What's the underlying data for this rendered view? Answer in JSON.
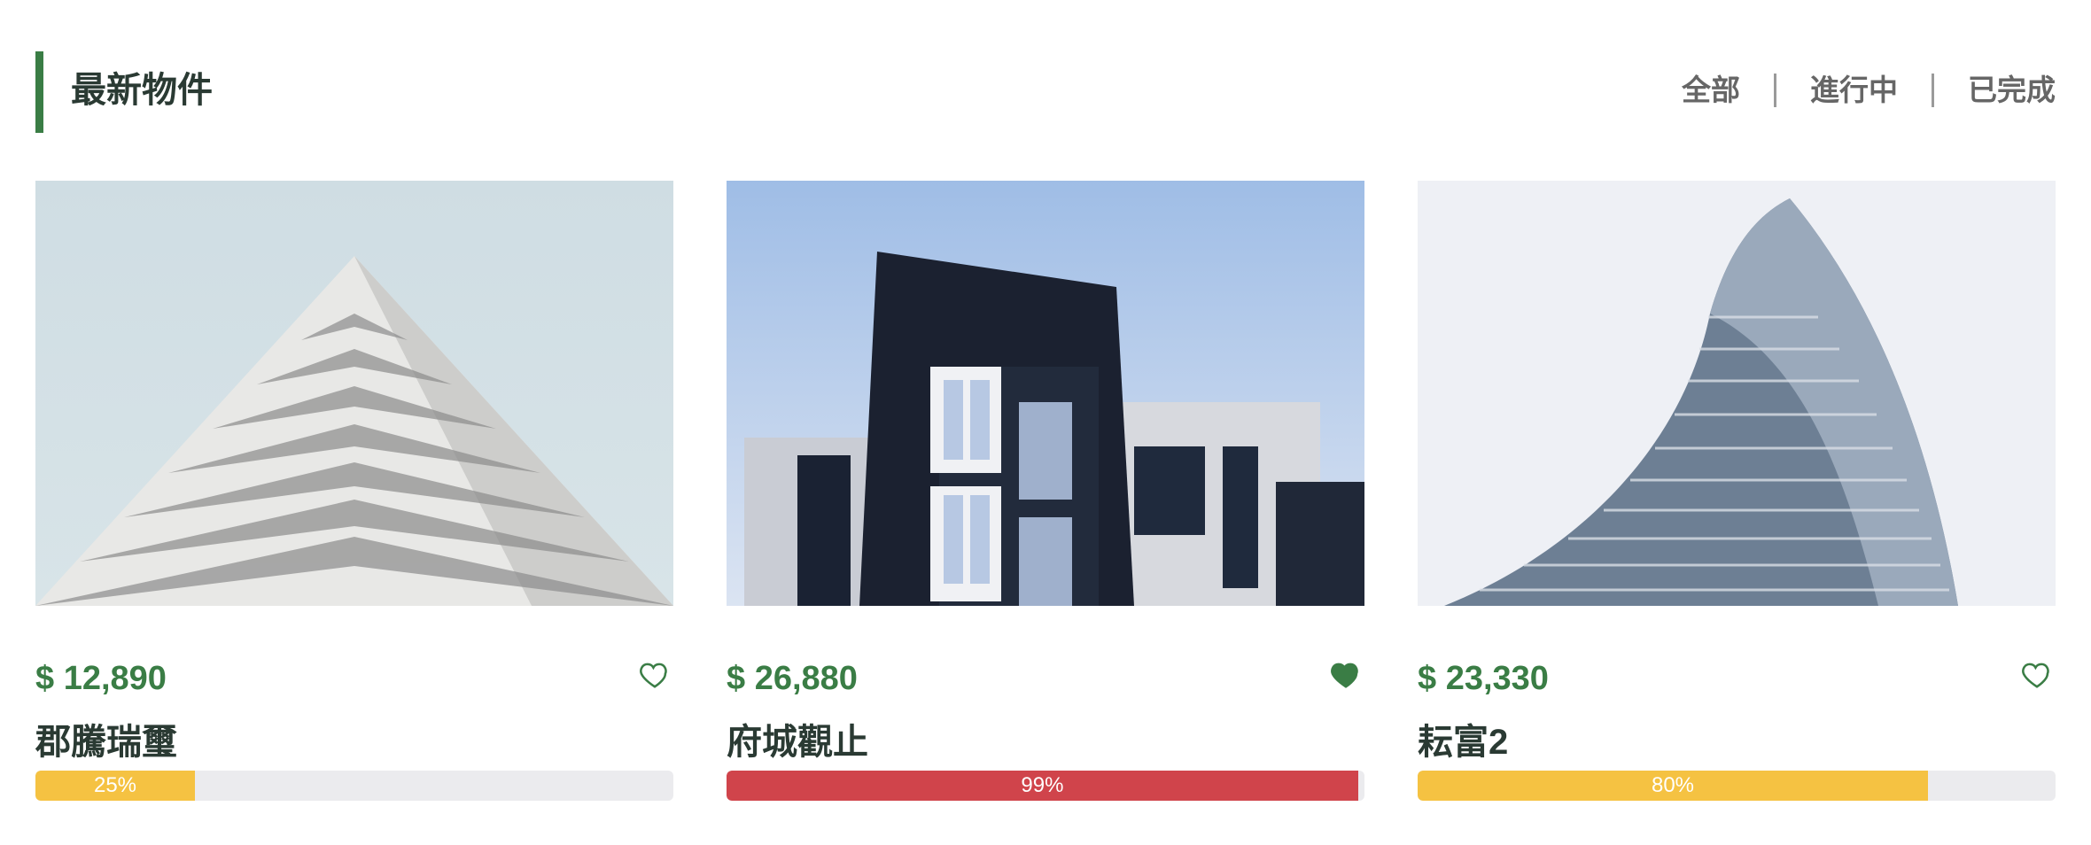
{
  "section": {
    "title": "最新物件",
    "accent_color": "#3a7d45",
    "filters": [
      {
        "label": "全部"
      },
      {
        "label": "進行中"
      },
      {
        "label": "已完成"
      }
    ]
  },
  "listings": [
    {
      "price": "$ 12,890",
      "name": "郡騰瑞璽",
      "progress": 0.25,
      "progress_label": "25%",
      "progress_color": "#f5c242",
      "favorited": false,
      "heart_icon": "heart-outline-icon"
    },
    {
      "price": "$ 26,880",
      "name": "府城觀止",
      "progress": 0.99,
      "progress_label": "99%",
      "progress_color": "#d0444b",
      "favorited": true,
      "heart_icon": "heart-filled-icon"
    },
    {
      "price": "$ 23,330",
      "name": "耘富2",
      "progress": 0.8,
      "progress_label": "80%",
      "progress_color": "#f5c242",
      "favorited": false,
      "heart_icon": "heart-outline-icon"
    }
  ]
}
